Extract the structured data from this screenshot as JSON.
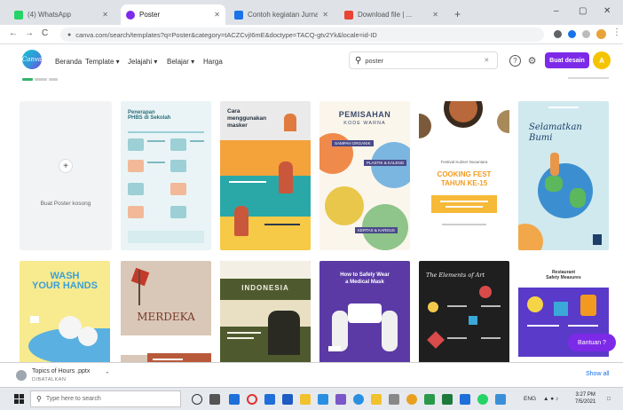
{
  "browser": {
    "tabs": [
      {
        "title": "(4) WhatsApp",
        "favicon_color": "#25d366"
      },
      {
        "title": "Poster",
        "favicon_color": "#7d2ae8"
      },
      {
        "title": "Contoh kegiatan Jurnal Tum...",
        "favicon_color": "#1a73e8"
      },
      {
        "title": "Download file | ...",
        "favicon_color": "#ea4335"
      }
    ],
    "active_tab_index": 1,
    "new_tab_label": "+",
    "window_controls": [
      "–",
      "▢",
      "✕"
    ],
    "address": "canva.com/search/templates?q=Poster&category=tACZCvjI6mE&doctype=TACQ-gtv2Yk&locale=id-ID",
    "nav": {
      "back": "←",
      "forward": "→",
      "reload": "C"
    }
  },
  "canva": {
    "logo_text": "Canva",
    "menu": [
      "Beranda",
      "Template ▾",
      "Jelajahi ▾",
      "Belajar ▾",
      "Harga"
    ],
    "search": {
      "value": "poster",
      "placeholder": "Telusuri",
      "clear": "✕"
    },
    "help_icon": "?",
    "settings_icon": "⚙",
    "create_button": "Buat desain",
    "avatar_initial": "A",
    "blank_card": {
      "plus": "+",
      "label": "Buat Poster kosong"
    },
    "templates": [
      {
        "title": "Penerapan\nPHBS di Sekolah"
      },
      {
        "title": "Cara\nmenggunakan\nmasker"
      },
      {
        "title": "PEMISAHAN",
        "subtitle": "KODE WARNA",
        "tags": [
          "SAMPAH ORGANIK",
          "PLASTIK & KALENG",
          "KERTAS & KARDUS"
        ]
      },
      {
        "title": "COOKING FEST\nTAHUN KE-15",
        "note": "Festival Kuliner Nusantara"
      },
      {
        "title": "Selamatkan\nBumi"
      },
      {
        "title": "WASH\nYOUR HANDS"
      },
      {
        "title": "MERDEKA"
      },
      {
        "title": "INDONESIA"
      },
      {
        "title": "How to Safely Wear\na Medical Mask"
      },
      {
        "title": "The Elements of Art"
      },
      {
        "title": "Restaurant\nSafety Measures"
      }
    ],
    "help_button": "Bantuan ?"
  },
  "download": {
    "file_name": "Topics of Hours .pptx",
    "status": "DIBATALKAN",
    "show_all": "Show all"
  },
  "taskbar": {
    "search_placeholder": "Type here to search",
    "apps": [
      "task-view",
      "file-explorer",
      "opera",
      "store",
      "word",
      "teams",
      "excel",
      "chrome",
      "mail",
      "folder",
      "edge",
      "whatsapp",
      "photos"
    ],
    "tray_language": "ENG",
    "clock_time": "3:27 PM",
    "clock_date": "7/5/2021"
  },
  "colors": {
    "accent": "#7d2ae8",
    "avatar": "#f5c400"
  }
}
